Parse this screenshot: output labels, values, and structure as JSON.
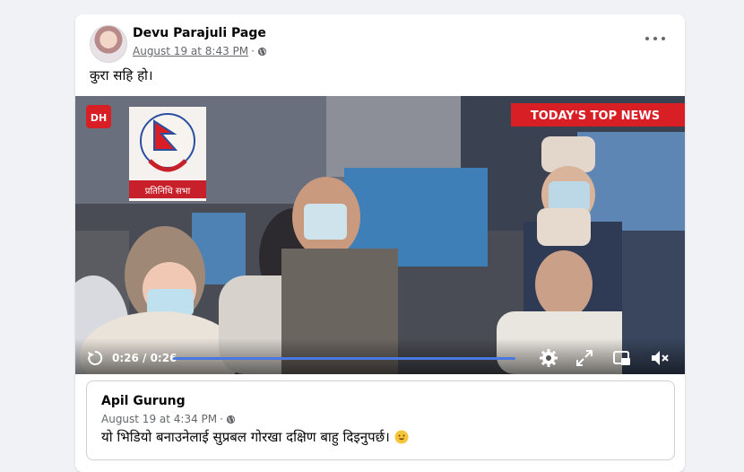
{
  "post": {
    "author": "Devu Parajuli Page",
    "timestamp": "August 19 at 8:43 PM",
    "separator": "·",
    "audience_icon": "globe-icon",
    "caption": "कुरा सहि हो।",
    "menu_icon": "more-options-icon"
  },
  "video": {
    "channel_badge": "DH",
    "logo_text": "प्रतिनिधि सभा",
    "banner": "TODAY'S TOP NEWS",
    "time": "0:26 / 0:26",
    "progress": 1.0,
    "controls": [
      "replay-icon",
      "settings-icon",
      "fullscreen-icon",
      "picture-in-picture-icon",
      "mute-icon"
    ]
  },
  "shared_post": {
    "author": "Apil Gurung",
    "timestamp": "August 19 at 4:34 PM",
    "separator": "·",
    "caption": "यो भिडियो बनाउनेलाई सुप्रबल गोरखा दक्षिण बाहु दिइनुपर्छ।",
    "emoji": "smiling-face-emoji"
  },
  "colors": {
    "page_bg": "#f0f2f5",
    "card_bg": "#ffffff",
    "secondary_text": "#65676b",
    "progress_fill": "#4a78e0",
    "banner_red": "#d81f26"
  }
}
